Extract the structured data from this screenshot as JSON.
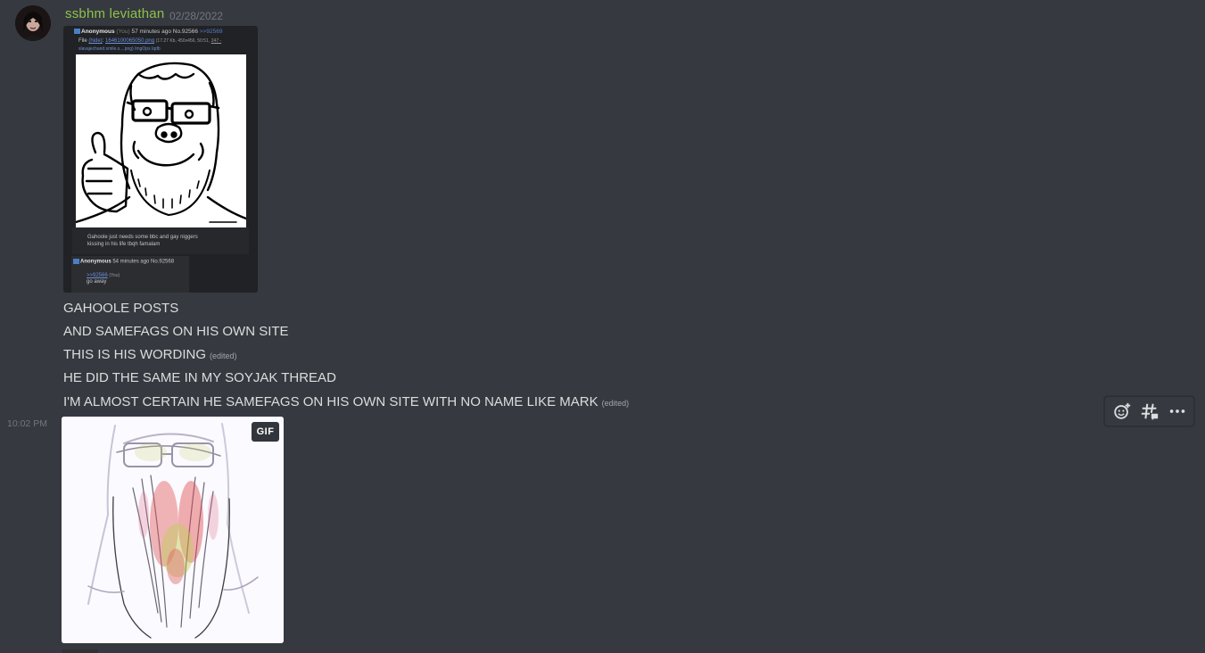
{
  "message": {
    "author": "ssbhm leviathan",
    "date": "02/28/2022",
    "author_color": "#8bc34a"
  },
  "screenshot_attachment": {
    "post_header_name": "Anonymous",
    "post_header_you": "(You)",
    "post_header_time": "57 minutes ago No.92566",
    "post_header_ref": ">>92569",
    "file_label": "File",
    "file_hide": "(hide)",
    "file_name": "1646100065050.png",
    "file_meta": "(17.27 Kb, 450x456, 50:51,",
    "file_link1": "247 -",
    "file_link2": "slavajechand.smile.s....png) ImgOps Iqdb",
    "caption_line1": "Gahoole just needs some bbc and gay niggers",
    "caption_line2": "kissing in his life tbqh famalam",
    "reply_name": "Anonymous",
    "reply_time": "54 minutes ago No.92568",
    "reply_ref": ">>92566",
    "reply_you": "(You)",
    "reply_text": "go away"
  },
  "lines": [
    {
      "text": "GAHOOLE POSTS",
      "edited": ""
    },
    {
      "text": "AND SAMEFAGS ON HIS OWN SITE",
      "edited": ""
    },
    {
      "text": "THIS IS HIS WORDING",
      "edited": "(edited)"
    },
    {
      "text": "HE DID THE SAME IN MY SOYJAK THREAD",
      "edited": ""
    },
    {
      "text": "I'M ALMOST CERTAIN HE SAMEFAGS ON HIS OWN SITE WITH NO NAME LIKE MARK",
      "edited": "(edited)"
    }
  ],
  "hover_timestamp": "10:02 PM",
  "gif_attachment": {
    "badge": "GIF"
  },
  "toolbar": {
    "icons": [
      "add-reaction-icon",
      "create-thread-icon",
      "more-icon"
    ]
  }
}
